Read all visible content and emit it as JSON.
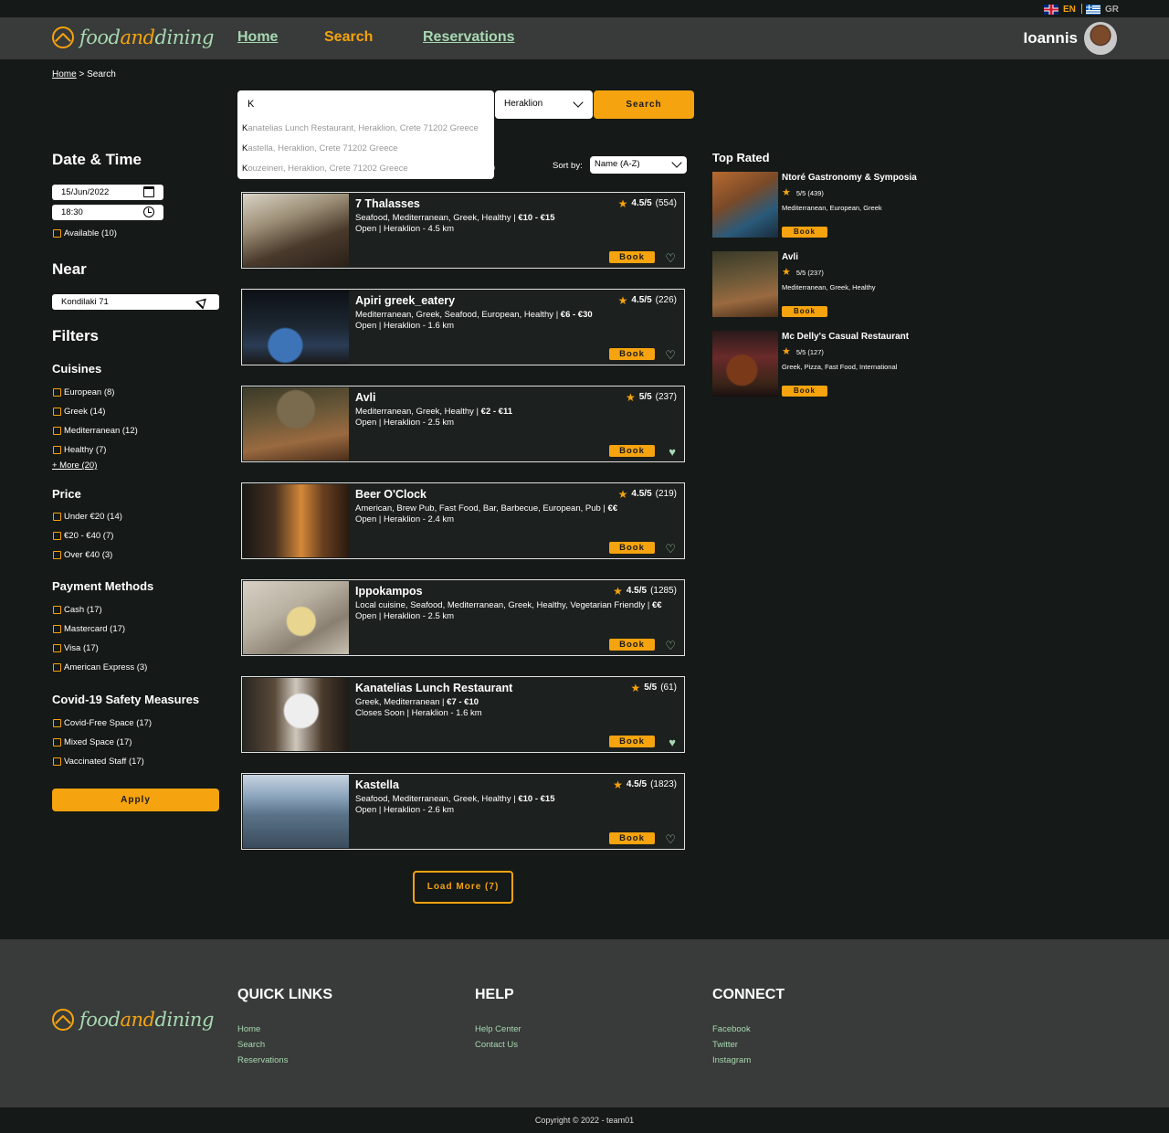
{
  "lang": {
    "en": "EN",
    "gr": "GR"
  },
  "brand": {
    "food": "food",
    "and": "and",
    "dining": "dining"
  },
  "nav": {
    "home": "Home",
    "search": "Search",
    "reservations": "Reservations"
  },
  "user": {
    "name": "Ioannis"
  },
  "breadcrumb": {
    "home": "Home",
    "sep": " > ",
    "current": "Search"
  },
  "search": {
    "query": "K",
    "city": "Heraklion",
    "button": "Search",
    "suggestions": [
      {
        "match": "K",
        "rest": "anatelias Lunch Restaurant, Heraklion, Crete 71202 Greece"
      },
      {
        "match": "K",
        "rest": "astella, Heraklion, Crete 71202 Greece"
      },
      {
        "match": "K",
        "rest": "ouzeineri, Heraklion, Crete 71202 Greece"
      }
    ],
    "result_count_fragment": ")"
  },
  "sidebar": {
    "datetime_title": "Date & Time",
    "date": "15/Jun/2022",
    "time": "18:30",
    "available": "Available (10)",
    "near_title": "Near",
    "near_value": "Kondilaki 71",
    "filters_title": "Filters",
    "cuisines_title": "Cuisines",
    "cuisines": [
      "European (8)",
      "Greek (14)",
      "Mediterranean (12)",
      "Healthy (7)"
    ],
    "more": "+ More (20)",
    "price_title": "Price",
    "prices": [
      "Under €20 (14)",
      "€20 - €40 (7)",
      "Over €40 (3)"
    ],
    "payment_title": "Payment Methods",
    "payments": [
      "Cash (17)",
      "Mastercard (17)",
      "Visa (17)",
      "American Express (3)"
    ],
    "covid_title": "Covid-19 Safety Measures",
    "covid": [
      "Covid-Free Space (17)",
      "Mixed Space (17)",
      "Vaccinated Staff (17)"
    ],
    "apply": "Apply"
  },
  "sort": {
    "label": "Sort by:",
    "value": "Name (A-Z)"
  },
  "results": [
    {
      "name": "7 Thalasses",
      "rating": "4.5/5",
      "count": "(554)",
      "cats": "Seafood, Mediterranean, Greek, Healthy | ",
      "price": "€10 - €15",
      "status": "Open | Heraklion - 4.5 km",
      "fav": false
    },
    {
      "name": "Apiri greek_eatery",
      "rating": "4.5/5",
      "count": "(226)",
      "cats": "Mediterranean, Greek, Seafood, European, Healthy | ",
      "price": "€6 - €30",
      "status": "Open | Heraklion - 1.6 km",
      "fav": false
    },
    {
      "name": "Avli",
      "rating": "5/5",
      "count": "(237)",
      "cats": "Mediterranean, Greek, Healthy | ",
      "price": "€2 - €11",
      "status": "Open | Heraklion - 2.5 km",
      "fav": true
    },
    {
      "name": "Beer O'Clock",
      "rating": "4.5/5",
      "count": "(219)",
      "cats": "American, Brew Pub, Fast Food, Bar, Barbecue, European, Pub | ",
      "price": "€€",
      "status": "Open | Heraklion - 2.4 km",
      "fav": false
    },
    {
      "name": "Ippokampos",
      "rating": "4.5/5",
      "count": "(1285)",
      "cats": "Local cuisine, Seafood, Mediterranean, Greek, Healthy, Vegetarian Friendly | ",
      "price": "€€",
      "status": "Open | Heraklion - 2.5 km",
      "fav": false
    },
    {
      "name": "Kanatelias Lunch Restaurant",
      "rating": "5/5",
      "count": "(61)",
      "cats": "Greek, Mediterranean | ",
      "price": "€7 - €10",
      "status": "Closes Soon | Heraklion - 1.6 km",
      "fav": true
    },
    {
      "name": "Kastella",
      "rating": "4.5/5",
      "count": "(1823)",
      "cats": "Seafood, Mediterranean, Greek, Healthy | ",
      "price": "€10 - €15",
      "status": "Open | Heraklion - 2.6 km",
      "fav": false
    }
  ],
  "book_label": "Book",
  "load_more": "Load More (7)",
  "top_rated": {
    "title": "Top Rated",
    "items": [
      {
        "name": "Ntoré Gastronomy & Symposia",
        "rating": "5/5 (439)",
        "cats": "Mediterranean, European, Greek"
      },
      {
        "name": "Avli",
        "rating": "5/5 (237)",
        "cats": "Mediterranean, Greek, Healthy"
      },
      {
        "name": "Mc Delly's Casual Restaurant",
        "rating": "5/5 (127)",
        "cats": "Greek, Pizza, Fast Food, International"
      }
    ]
  },
  "footer": {
    "quick_links_title": "QUICK LINKS",
    "quick_links": [
      "Home",
      "Search",
      "Reservations"
    ],
    "help_title": "HELP",
    "help": [
      "Help Center",
      "Contact Us"
    ],
    "connect_title": "CONNECT",
    "connect": [
      "Facebook",
      "Twitter",
      "Instagram"
    ],
    "copyright": "Copyright © 2022 - team01"
  },
  "colors": {
    "accent": "#f5a30e",
    "mint": "#a8d8b2",
    "bg": "#151917",
    "header": "#383b39"
  },
  "icons": [
    "uk-flag-icon",
    "greek-flag-icon",
    "logo-icon",
    "calendar-icon",
    "clock-icon",
    "location-arrow-icon",
    "chevron-down-icon",
    "star-icon",
    "heart-icon"
  ]
}
